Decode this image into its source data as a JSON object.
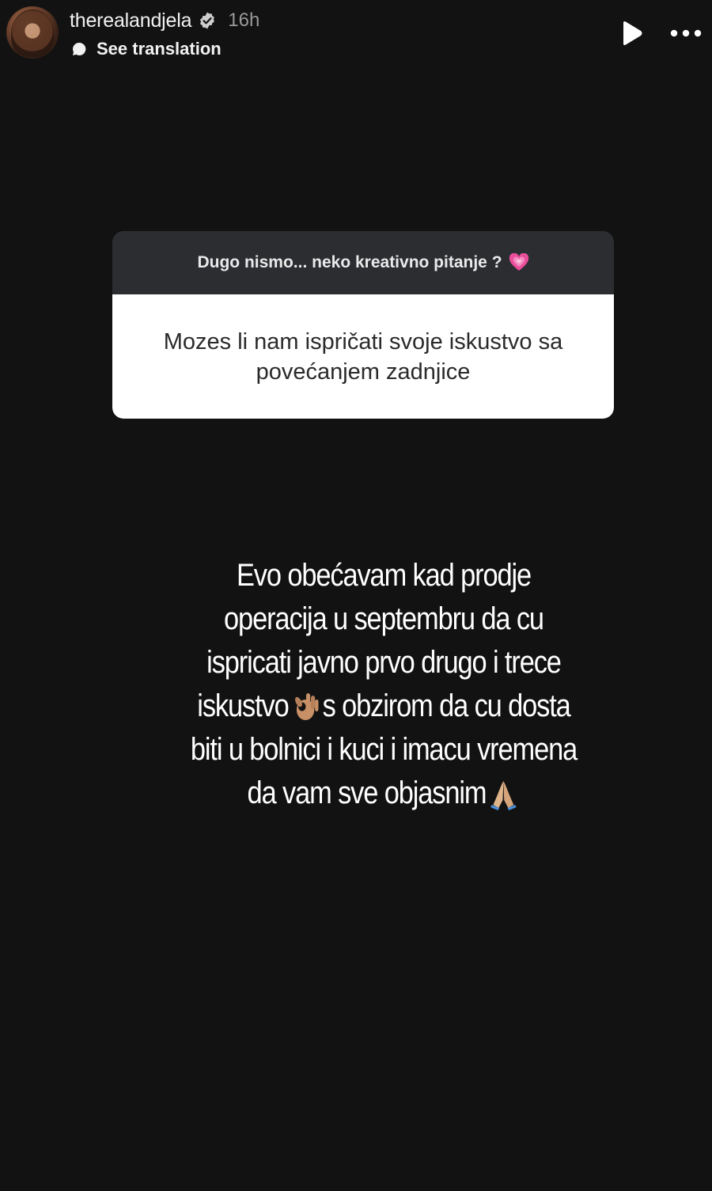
{
  "header": {
    "username": "therealandjela",
    "verified_icon": "verified-badge-icon",
    "time_ago": "16h",
    "translation_label": "See translation",
    "play_icon": "play-icon",
    "more_icon": "more-options-icon"
  },
  "question_sticker": {
    "prompt": "Dugo nismo... neko kreativno pitanje ?",
    "prompt_emoji": "growing-heart-icon",
    "question": "Mozes li nam ispričati svoje iskustvo sa povećanjem zadnjice"
  },
  "answer": {
    "lines": [
      "Evo obećavam kad prodje",
      "operacija u septembru da cu",
      "ispricati javno prvo drugo i trece",
      "iskustvo",
      "s obzirom da cu dosta",
      "biti u bolnici i kuci i imacu vremena",
      "da vam sve objasnim"
    ],
    "ok_emoji": "ok-hand-icon",
    "pray_emoji": "folded-hands-icon"
  },
  "colors": {
    "background": "#121212",
    "card_header": "#2b2d31",
    "card_body": "#ffffff",
    "muted_text": "#9a9a9a"
  }
}
